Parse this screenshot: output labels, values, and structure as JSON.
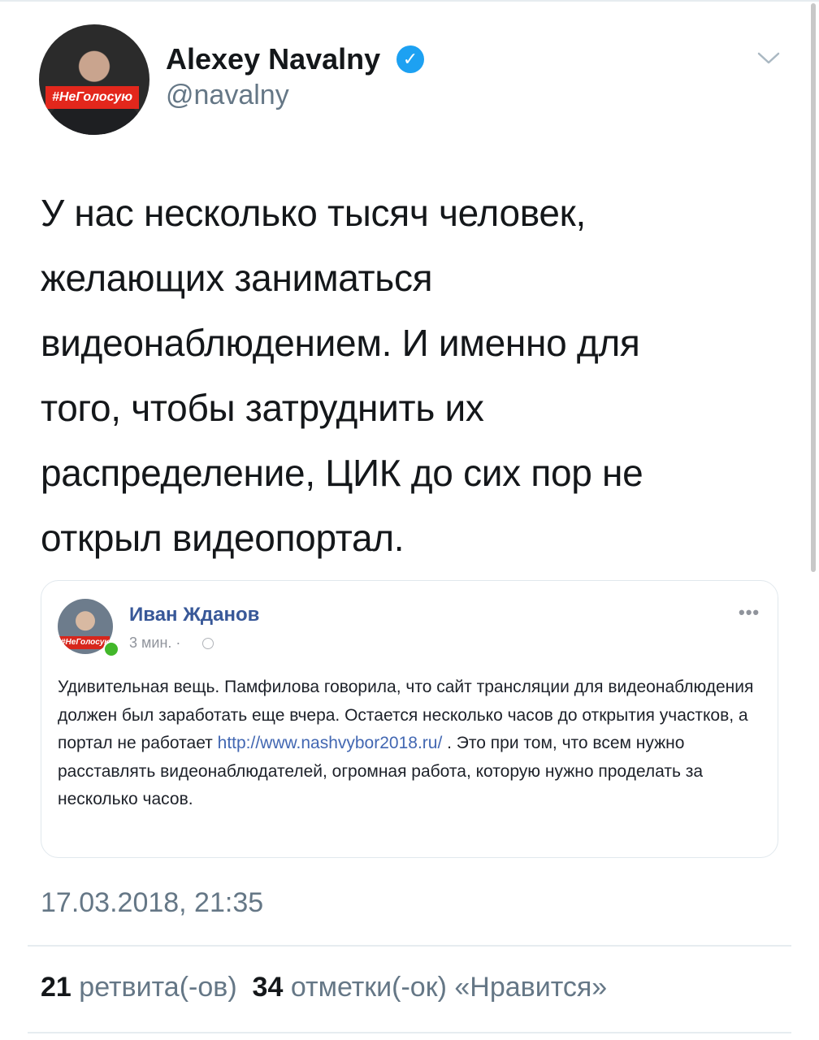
{
  "tweet": {
    "author_name": "Alexey Navalny",
    "handle": "@navalny",
    "avatar_badge": "#НеГолосую",
    "verified_icon": "verified-badge-icon",
    "menu_icon": "chevron-down-icon",
    "text": "У нас несколько тысяч человек,\nжелающих заниматься\nвидеонаблюдением. И именно для\nтого, чтобы затруднить их\nраспределение, ЦИК до сих пор не\nоткрыл видеопортал.",
    "timestamp": "17.03.2018, 21:35",
    "retweets_count": "21",
    "retweets_label": "ретвита(-ов)",
    "likes_count": "34",
    "likes_label": "отметки(-ок) «Нравится»"
  },
  "quoted_post": {
    "author_name": "Иван Жданов",
    "avatar_badge": "#НеГолосую",
    "time": "3 мин. ·",
    "more_icon": "ellipsis-icon",
    "text_before_link": "Удивительная вещь. Памфилова говорила, что сайт трансляции для видеонаблюдения должен был заработать еще вчера. Остается несколько часов до открытия участков, а портал не работает ",
    "link": "http://www.nashvybor2018.ru/",
    "text_after_link": " . Это при том, что всем нужно расставлять видеонаблюдателей, огромная работа, которую нужно проделать за несколько часов."
  },
  "colors": {
    "verified": "#1da1f2",
    "facebook_name": "#385898",
    "facebook_link": "#4267b2",
    "secondary_text": "#657786",
    "badge_red": "#e3271c",
    "online_green": "#42b72a"
  }
}
